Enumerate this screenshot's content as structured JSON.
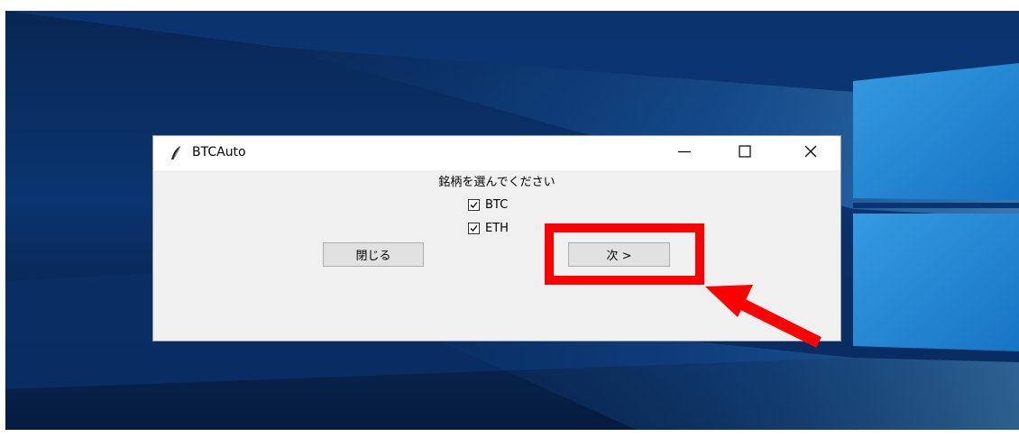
{
  "window": {
    "title": "BTCAuto",
    "icon": "feather-icon",
    "controls": {
      "minimize_icon": "minimize-icon",
      "maximize_icon": "maximize-icon",
      "close_icon": "close-icon"
    }
  },
  "content": {
    "prompt": "銘柄を選んでください",
    "options": [
      {
        "label": "BTC",
        "checked": true
      },
      {
        "label": "ETH",
        "checked": true
      }
    ],
    "buttons": {
      "close_label": "閉じる",
      "next_label": "次 >"
    }
  },
  "annotation": {
    "highlight_color": "#ff0000",
    "arrow_color": "#ff0000"
  },
  "colors": {
    "window_bg": "#f0f0f0",
    "titlebar_bg": "#ffffff",
    "desktop_blue": "#1e90ff"
  }
}
